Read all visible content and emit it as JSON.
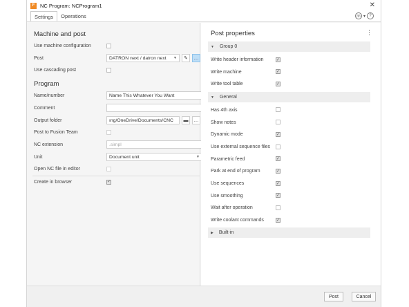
{
  "window": {
    "title": "NC Program: NCProgram1",
    "app_icon_letter": "F"
  },
  "tabs": [
    {
      "label": "Settings",
      "active": true
    },
    {
      "label": "Operations",
      "active": false
    }
  ],
  "machine_and_post": {
    "title": "Machine and post",
    "use_machine_configuration": {
      "label": "Use machine configuration",
      "checked": false
    },
    "post": {
      "label": "Post",
      "value": "DATRON next / datron next"
    },
    "use_cascading_post": {
      "label": "Use cascading post",
      "checked": false
    }
  },
  "program": {
    "title": "Program",
    "name_number": {
      "label": "Name/number",
      "value": "Name This Whatever You Want"
    },
    "comment": {
      "label": "Comment",
      "value": ""
    },
    "output_folder": {
      "label": "Output folder",
      "value": "ıng/OneDrive/Documents/CNC"
    },
    "post_to_fusion_team": {
      "label": "Post to Fusion Team",
      "checked": false
    },
    "nc_extension": {
      "label": "NC extension",
      "placeholder": ".simpl"
    },
    "unit": {
      "label": "Unit",
      "value": "Document unit"
    },
    "open_nc_file": {
      "label": "Open NC file in editor",
      "checked": false
    },
    "create_in_browser": {
      "label": "Create in browser",
      "checked": true
    }
  },
  "post_properties": {
    "title": "Post properties",
    "group0": {
      "label": "Group 0",
      "items": [
        {
          "label": "Write header information",
          "checked": true
        },
        {
          "label": "Write machine",
          "checked": true
        },
        {
          "label": "Write tool table",
          "checked": true
        }
      ]
    },
    "general": {
      "label": "General",
      "items": [
        {
          "label": "Has 4th axis",
          "checked": false
        },
        {
          "label": "Show notes",
          "checked": false
        },
        {
          "label": "Dynamic mode",
          "checked": true
        },
        {
          "label": "Use external sequence files",
          "checked": false
        },
        {
          "label": "Parametric feed",
          "checked": true
        },
        {
          "label": "Park at end of program",
          "checked": true
        },
        {
          "label": "Use sequences",
          "checked": true
        },
        {
          "label": "Use smoothing",
          "checked": true
        },
        {
          "label": "Wait after operation",
          "checked": false
        },
        {
          "label": "Write coolant commands",
          "checked": true
        }
      ]
    },
    "builtin": {
      "label": "Built-in"
    }
  },
  "buttons": {
    "post": "Post",
    "cancel": "Cancel"
  },
  "icons": {
    "close": "close-icon",
    "kebab": "more-vertical-icon",
    "edit": "pencil-icon",
    "folder": "folder-icon",
    "help": "help-icon",
    "phone": "headset-icon"
  },
  "check_mark": "✓"
}
